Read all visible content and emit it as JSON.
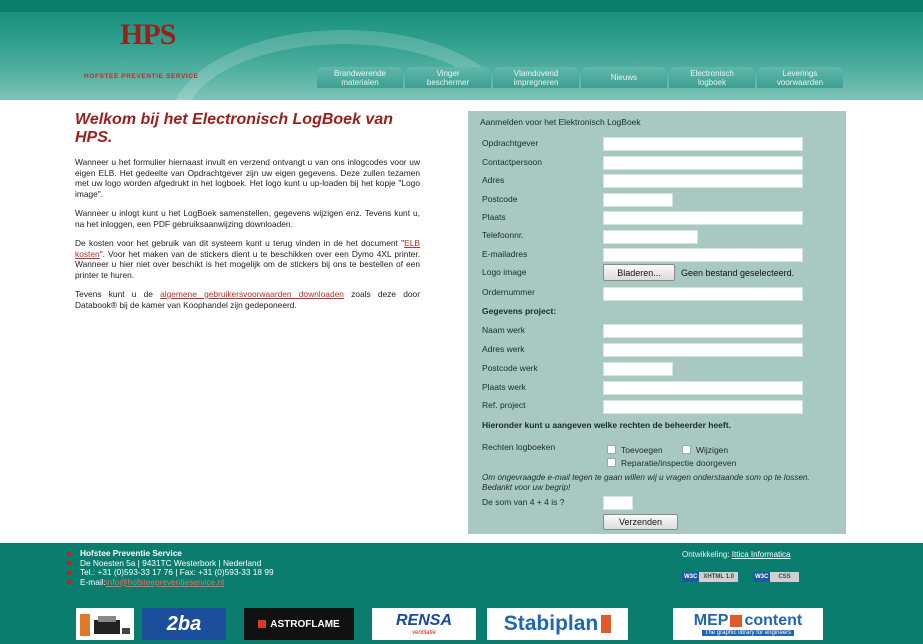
{
  "header": {
    "logo_letters": "HPS",
    "logo_tagline": "HOFSTEE PREVENTIE SERVICE",
    "nav": [
      {
        "line1": "Brandwerende",
        "line2": "materialen"
      },
      {
        "line1": "Vinger",
        "line2": "beschermer"
      },
      {
        "line1": "Vlamdovend",
        "line2": "impregneren"
      },
      {
        "line1": "Nieuws",
        "line2": ""
      },
      {
        "line1": "Electronisch",
        "line2": "logboek"
      },
      {
        "line1": "Leverings",
        "line2": "voorwaarden"
      }
    ]
  },
  "intro": {
    "title": "Welkom bij het Electronisch LogBoek van HPS.",
    "p1": "Wanneer u het formulier hiernaast invult en verzend ontvangt u van ons inlogcodes voor uw eigen ELB. Het gedeelte van Opdrachtgever zijn uw eigen gegevens. Deze zullen tezamen met uw logo worden afgedrukt in het logboek. Het logo kunt u up-loaden bij het kopje \"Logo image\".",
    "p2": "Wanneer u inlogt kunt u het LogBoek samenstellen, gegevens wijzigen enz. Tevens kunt u, na het inloggen, een PDF gebruiksaanwijzing downloaden.",
    "p3_before": "De kosten voor het gebruik van dit systeem kunt u terug vinden in de het document \"",
    "p3_link": "ELB kosten",
    "p3_after": "\". Voor het maken van de stickers dient u te beschikken over een Dymo 4XL printer. Wanneer u hier niet over beschikt is het mogelijk om de stickers bij ons te bestellen of een printer te huren.",
    "p4_before": "Tevens kunt u de ",
    "p4_link": "algemene gebruikersvoorwaarden downloaden",
    "p4_after": " zoals deze door Databook® bij de kamer van Koophandel zijn gedeponeerd."
  },
  "form": {
    "title": "Aanmelden voor het Elektronisch LogBoek",
    "fields": {
      "opdrachtgever": "Opdrachtgever",
      "contactpersoon": "Contactpersoon",
      "adres": "Adres",
      "postcode": "Postcode",
      "plaats": "Plaats",
      "telefoon": "Telefoonnr.",
      "email": "E-mailadres",
      "logo": "Logo image",
      "ordernummer": "Ordernummer",
      "project_heading": "Gegevens project:",
      "naam_werk": "Naam werk",
      "adres_werk": "Adres werk",
      "postcode_werk": "Postcode werk",
      "plaats_werk": "Plaats werk",
      "ref_project": "Ref. project"
    },
    "browse_button": "Bladeren...",
    "no_file": "Geen bestand geselecteerd.",
    "rights_heading": "Hieronder kunt u aangeven welke rechten de beheerder heeft.",
    "rights_label": "Rechten logboeken",
    "rights_options": [
      "Toevoegen",
      "Wijzigen",
      "Reparatie/inspectie doorgeven"
    ],
    "captcha_note": "Om ongevraagde e-mail tegen te gaan willen wij u vragen onderstaande som op te lossen. Bedankt voor uw begrip!",
    "captcha_question": "De som van 4 + 4 is ?",
    "submit": "Verzenden"
  },
  "footer": {
    "company": "Hofstee Preventie Service",
    "address": "De Noesten 5a | 9431TC Westerbork | Nederland",
    "phone": "Tel.: +31 (0)593-33 17 76 | Fax: +31 (0)593-33 18 99",
    "email_label": "E-mail: ",
    "email_value": "info@hofsteepreventieservice.nl",
    "dev_label": "Ontwikkeling: ",
    "dev_link": "Ittica Informatica",
    "badge1_a": "W3C",
    "badge1_b": "XHTML 1.0",
    "badge2_a": "W3C",
    "badge2_b": "CSS",
    "sponsors": [
      "2ba",
      "ASTROFLAME",
      "RENSA",
      "ventilatie",
      "Stabiplan",
      "MEP",
      "content",
      "The graphic library for engineers"
    ]
  },
  "colors": {
    "header_teal": "#0e8a78",
    "brand_red": "#9c1f1a",
    "panel_bg": "#a7c9c1",
    "footer_teal": "#0b7d6e"
  }
}
